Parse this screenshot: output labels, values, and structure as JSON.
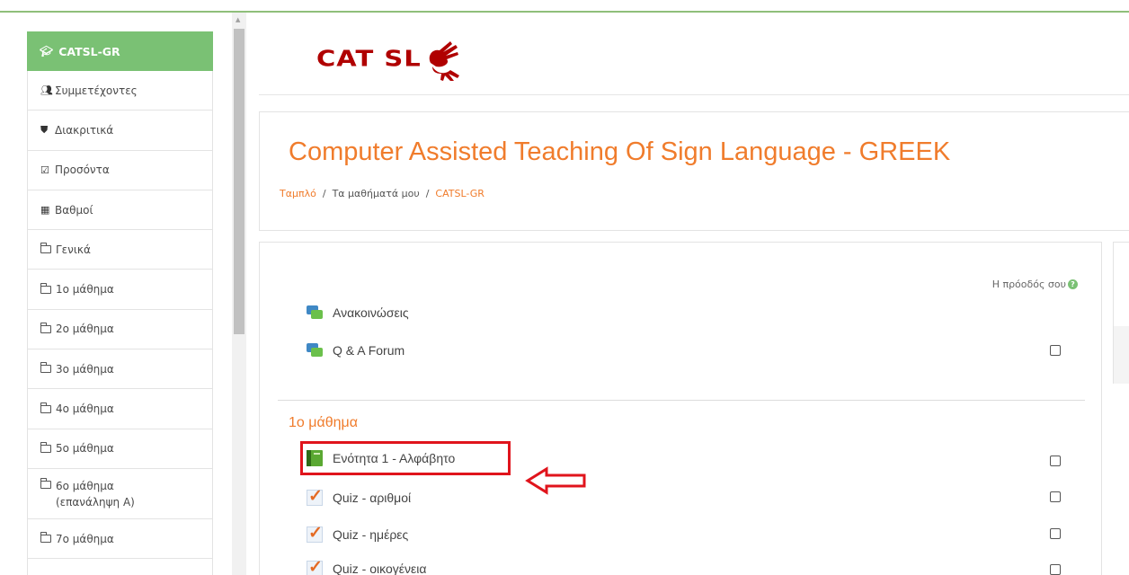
{
  "sidebar": {
    "course": "CATSL-GR",
    "items": [
      {
        "label": "Συμμετέχοντες",
        "icon": "users-icon"
      },
      {
        "label": "Διακριτικά",
        "icon": "shield-icon"
      },
      {
        "label": "Προσόντα",
        "icon": "checkbox-icon"
      },
      {
        "label": "Βαθμοί",
        "icon": "table-icon"
      },
      {
        "label": "Γενικά",
        "icon": "folder-icon"
      },
      {
        "label": "1ο μάθημα",
        "icon": "folder-icon"
      },
      {
        "label": "2ο μάθημα",
        "icon": "folder-icon"
      },
      {
        "label": "3ο μάθημα",
        "icon": "folder-icon"
      },
      {
        "label": "4ο μάθημα",
        "icon": "folder-icon"
      },
      {
        "label": "5ο μάθημα",
        "icon": "folder-icon"
      },
      {
        "label": "6ο μάθημα",
        "label2": "(επανάληψη Α)",
        "icon": "folder-icon"
      },
      {
        "label": "7ο μάθημα",
        "icon": "folder-icon"
      }
    ]
  },
  "logo": {
    "text": "CAT SL"
  },
  "header": {
    "title": "Computer Assisted Teaching Of Sign Language - GREEK",
    "breadcrumb": [
      "Ταμπλό",
      "Τα μαθήματά μου",
      "CATSL-GR"
    ]
  },
  "content": {
    "progress_label": "Η πρόοδός σου",
    "activities": [
      {
        "label": "Ανακοινώσεις",
        "type": "forum"
      },
      {
        "label": "Q & A Forum",
        "type": "forum"
      }
    ],
    "section": {
      "title": "1ο μάθημα",
      "activities": [
        {
          "label": "Ενότητα 1 - Αλφάβητο",
          "type": "book"
        },
        {
          "label": "Quiz - αριθμοί",
          "type": "quiz"
        },
        {
          "label": "Quiz - ημέρες",
          "type": "quiz"
        },
        {
          "label": "Quiz - οικογένεια",
          "type": "quiz"
        }
      ]
    }
  },
  "colors": {
    "accent": "#f07c2c",
    "sidebar_header": "#7ac174",
    "highlight": "#e0141c"
  }
}
